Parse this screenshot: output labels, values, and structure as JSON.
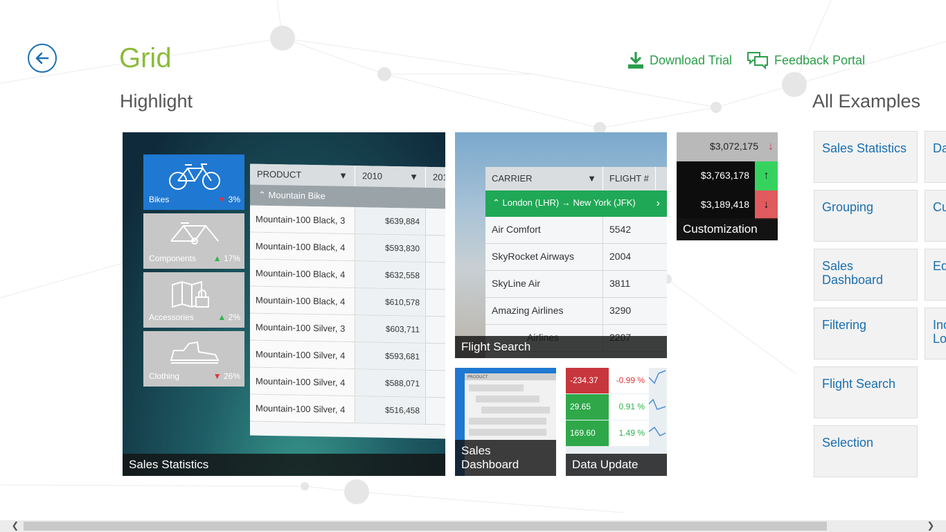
{
  "header": {
    "title": "Grid",
    "download_label": "Download Trial",
    "feedback_label": "Feedback Portal"
  },
  "sections": {
    "highlight": "Highlight",
    "all_examples": "All Examples"
  },
  "tiles": {
    "sales_statistics": {
      "caption": "Sales Statistics",
      "categories": [
        {
          "label": "Bikes",
          "pct": "3%",
          "trend": "down"
        },
        {
          "label": "Components",
          "pct": "17%",
          "trend": "up"
        },
        {
          "label": "Accessories",
          "pct": "2%",
          "trend": "up"
        },
        {
          "label": "Clothing",
          "pct": "26%",
          "trend": "down"
        }
      ],
      "headers": [
        "PRODUCT",
        "2010",
        "201"
      ],
      "group": "Mountain Bike",
      "rows": [
        {
          "product": "Mountain-100 Black, 3",
          "value": "$639,884"
        },
        {
          "product": "Mountain-100 Black, 4",
          "value": "$593,830"
        },
        {
          "product": "Mountain-100 Black, 4",
          "value": "$632,558"
        },
        {
          "product": "Mountain-100 Black, 4",
          "value": "$610,578"
        },
        {
          "product": "Mountain-100 Silver, 3",
          "value": "$603,711"
        },
        {
          "product": "Mountain-100 Silver, 4",
          "value": "$593,681"
        },
        {
          "product": "Mountain-100 Silver, 4",
          "value": "$588,071"
        },
        {
          "product": "Mountain-100 Silver, 4",
          "value": "$516,458"
        }
      ]
    },
    "flight_search": {
      "caption": "Flight Search",
      "headers": [
        "CARRIER",
        "FLIGHT #"
      ],
      "route_from": "London (LHR)",
      "route_arrow": "→",
      "route_to": "New York (JFK)",
      "rows": [
        {
          "carrier": "Air Comfort",
          "flight": "5542"
        },
        {
          "carrier": "SkyRocket Airways",
          "flight": "2004"
        },
        {
          "carrier": "SkyLine Air",
          "flight": "3811"
        },
        {
          "carrier": "Amazing Airlines",
          "flight": "3290"
        },
        {
          "carrier": "Airlines",
          "flight": "2207"
        }
      ]
    },
    "customization": {
      "caption": "Customization",
      "rows": [
        {
          "value": "$3,072,175",
          "arrow": "↓"
        },
        {
          "value": "$3,763,178",
          "arrow": "↑"
        },
        {
          "value": "$3,189,418",
          "arrow": "↓"
        }
      ]
    },
    "sales_dashboard": {
      "caption_line1": "Sales",
      "caption_line2": "Dashboard",
      "mini_header": "PRODUCT"
    },
    "data_update": {
      "caption": "Data Update",
      "rows": [
        {
          "value": "-234.37",
          "pct": "-0.99 %"
        },
        {
          "value": "29.65",
          "pct": "0.91 %"
        },
        {
          "value": "169.60",
          "pct": "1.49 %"
        }
      ]
    }
  },
  "examples": [
    {
      "label": "Sales Statistics"
    },
    {
      "label": "Grouping"
    },
    {
      "label": "Sales Dashboard"
    },
    {
      "label": "Filtering"
    },
    {
      "label": "Flight Search"
    },
    {
      "label": "Selection"
    }
  ],
  "examples_col2": [
    {
      "label": "Da"
    },
    {
      "label": "Cu"
    },
    {
      "label": "Ed"
    },
    {
      "label": "Inc Lo"
    }
  ],
  "colors": {
    "accent_green": "#2c9e4b",
    "title_green": "#8bbb3a",
    "link_blue": "#1a6fb0",
    "up_green": "#2fb24c",
    "down_red": "#e0363c"
  }
}
